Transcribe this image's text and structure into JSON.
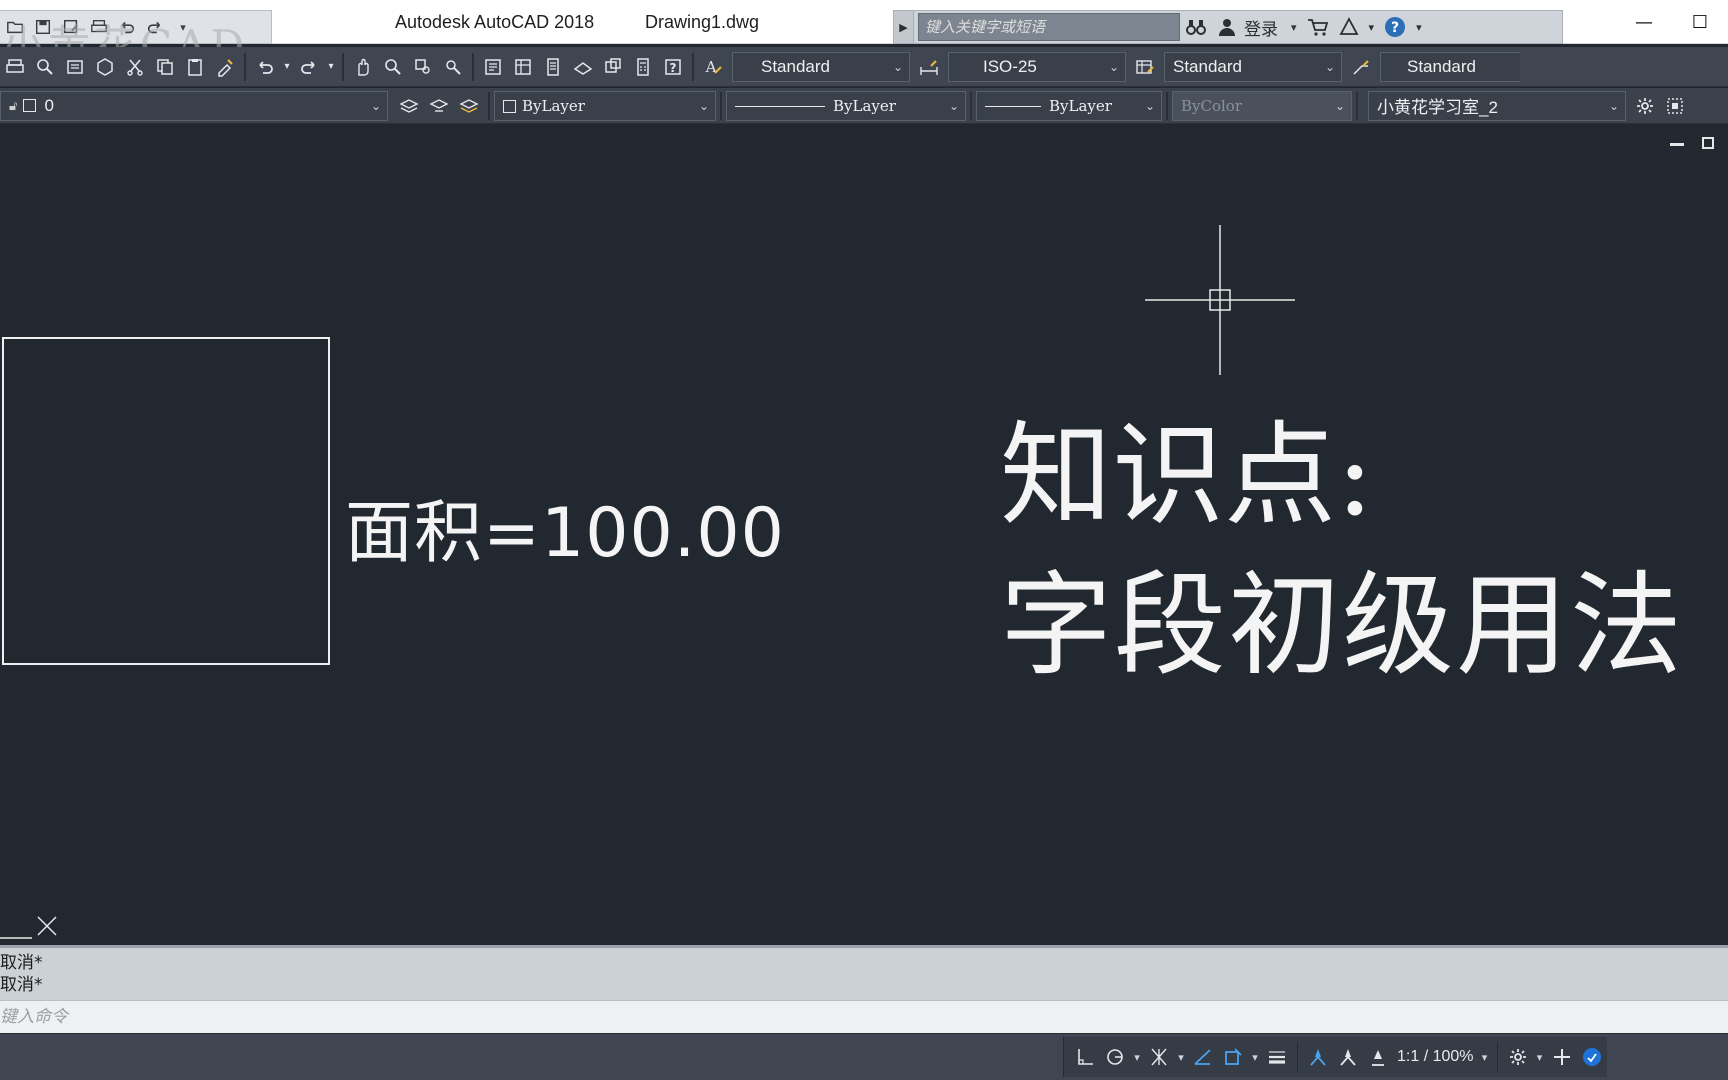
{
  "window": {
    "app_title": "Autodesk AutoCAD 2018",
    "doc_title": "Drawing1.dwg",
    "watermark": "小黄花CAD"
  },
  "search": {
    "placeholder": "键入关键字或短语",
    "login_label": "登录"
  },
  "toolbar": {
    "text_style": "Standard",
    "dim_style": "ISO-25",
    "table_style": "Standard",
    "multileader_style": "Standard"
  },
  "layer_bar": {
    "current_layer": "0",
    "color": "ByLayer",
    "linetype": "ByLayer",
    "lineweight": "ByLayer",
    "plot_style": "ByColor",
    "workspace": "小黄花学习室_2"
  },
  "canvas": {
    "area_text": "面积=100.00",
    "knowledge_title": "知识点:",
    "knowledge_topic": "字段初级用法"
  },
  "command": {
    "history": [
      "取消*",
      "取消*"
    ],
    "placeholder": "键入命令"
  },
  "status": {
    "scale": "1:1 / 100%"
  },
  "colors": {
    "canvas_bg": "#212830",
    "toolbar_bg": "#3f4651",
    "accent": "#4aa3f0",
    "drawing_lines": "#f4f4f4"
  }
}
